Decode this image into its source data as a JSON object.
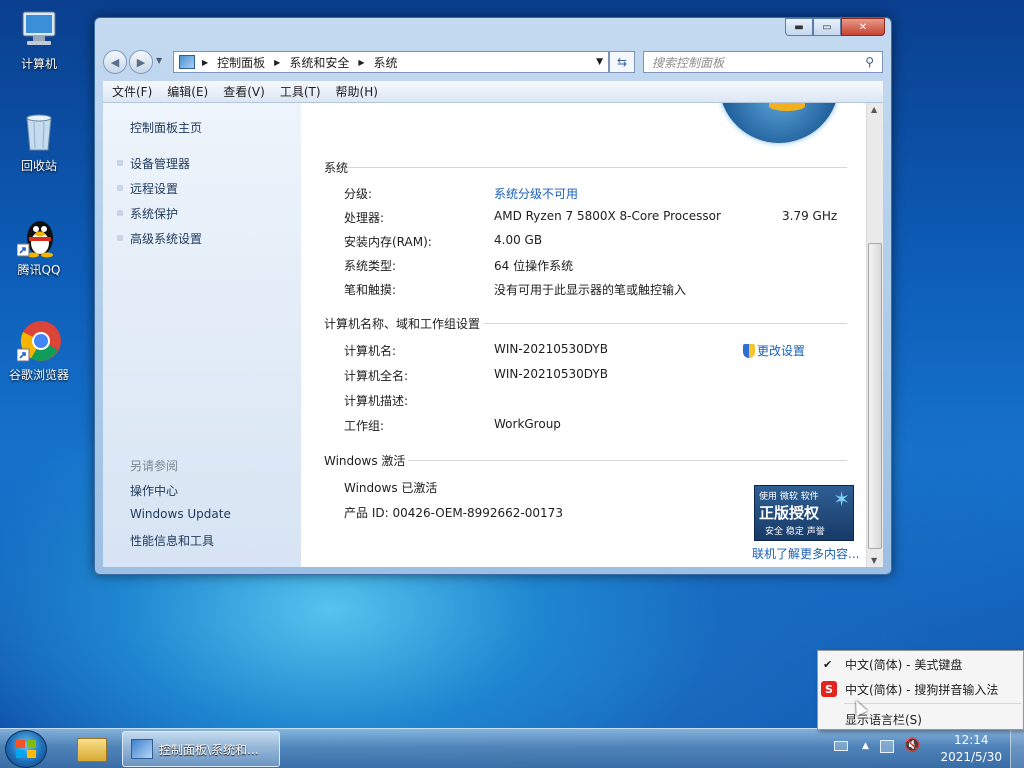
{
  "desktop": {
    "icons": [
      {
        "label": "计算机"
      },
      {
        "label": "回收站"
      },
      {
        "label": "腾讯QQ"
      },
      {
        "label": "谷歌浏览器"
      }
    ]
  },
  "window": {
    "breadcrumb": [
      "控制面板",
      "系统和安全",
      "系统"
    ],
    "search_placeholder": "搜索控制面板",
    "menu": [
      "文件(F)",
      "编辑(E)",
      "查看(V)",
      "工具(T)",
      "帮助(H)"
    ],
    "left_pane": {
      "home": "控制面板主页",
      "tasks": [
        "设备管理器",
        "远程设置",
        "系统保护",
        "高级系统设置"
      ],
      "see_also_title": "另请参阅",
      "see_also": [
        "操作中心",
        "Windows Update",
        "性能信息和工具"
      ]
    },
    "system": {
      "title": "系统",
      "rating_label": "分级:",
      "rating_value": "系统分级不可用",
      "processor_label": "处理器:",
      "processor_value": "AMD Ryzen 7 5800X 8-Core Processor",
      "processor_speed": "3.79 GHz",
      "ram_label": "安装内存(RAM):",
      "ram_value": "4.00 GB",
      "type_label": "系统类型:",
      "type_value": "64 位操作系统",
      "pen_label": "笔和触摸:",
      "pen_value": "没有可用于此显示器的笔或触控输入"
    },
    "computer": {
      "title": "计算机名称、域和工作组设置",
      "name_label": "计算机名:",
      "name_value": "WIN-20210530DYB",
      "fullname_label": "计算机全名:",
      "fullname_value": "WIN-20210530DYB",
      "desc_label": "计算机描述:",
      "workgroup_label": "工作组:",
      "workgroup_value": "WorkGroup",
      "change_settings": "更改设置"
    },
    "activation": {
      "title": "Windows 激活",
      "status": "Windows 已激活",
      "product_id": "产品 ID: 00426-OEM-8992662-00173",
      "badge_top": "使用 微软 软件",
      "badge_main": "正版授权",
      "badge_sub": "安全 稳定 声誉",
      "learn_more": "联机了解更多内容..."
    }
  },
  "taskbar": {
    "active_item": "控制面板\\系统和...",
    "time": "12:14",
    "date": "2021/5/30"
  },
  "language_popup": {
    "items": [
      "中文(简体) - 美式键盘",
      "中文(简体) - 搜狗拼音输入法",
      "显示语言栏(S)"
    ]
  },
  "colors": {
    "link": "#1a5fb8",
    "sogou": "#e2251c"
  }
}
